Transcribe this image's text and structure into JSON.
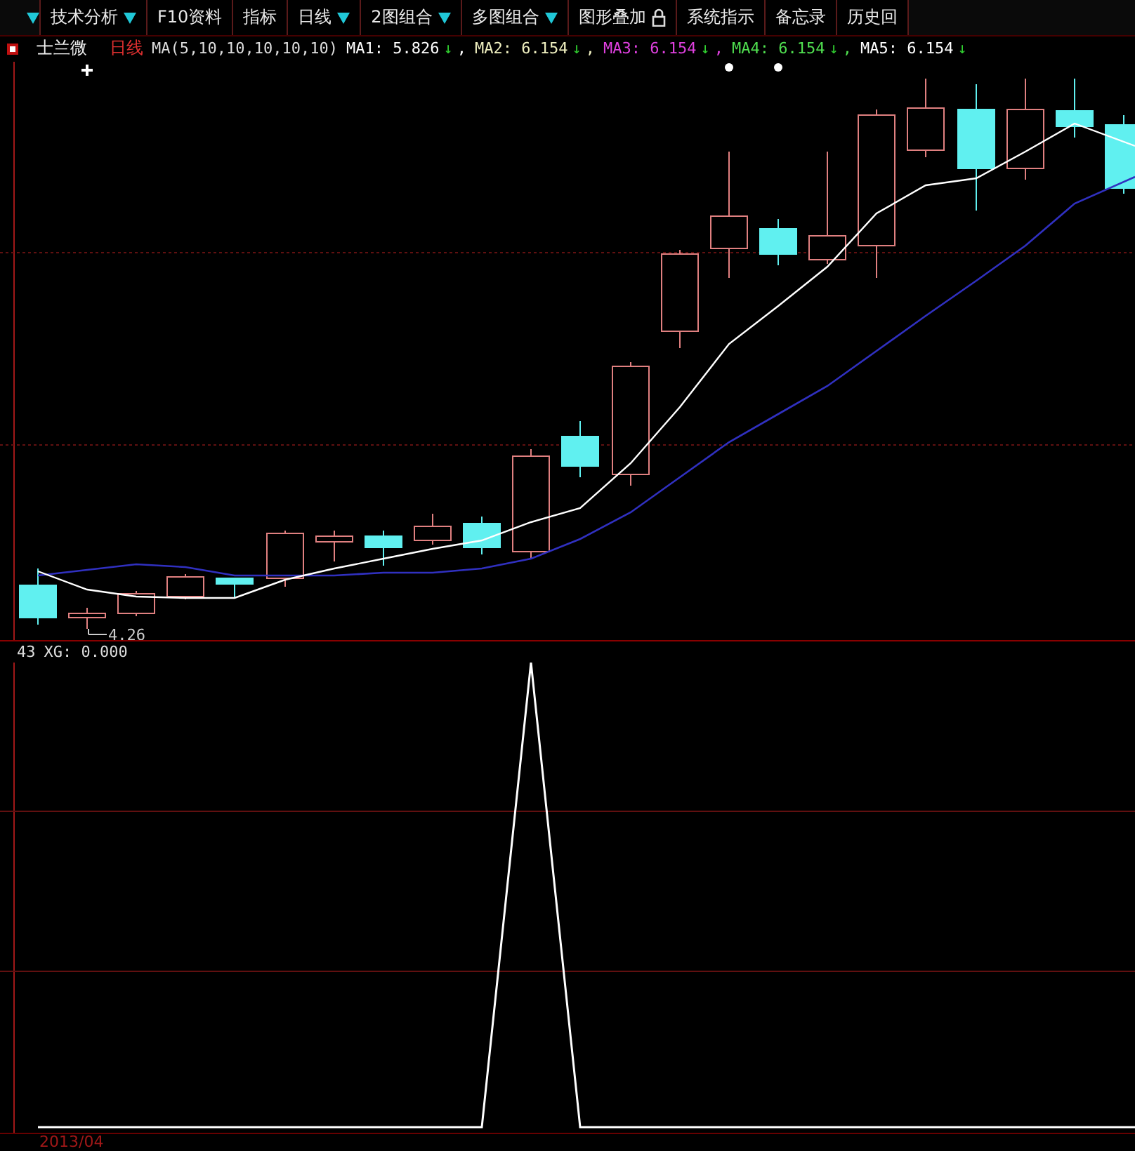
{
  "toolbar": {
    "buttons": [
      {
        "label": "技术分析",
        "dropdown": true
      },
      {
        "label": "F10资料",
        "dropdown": false
      },
      {
        "label": "指标",
        "dropdown": false
      },
      {
        "label": "日线",
        "dropdown": true
      },
      {
        "label": "2图组合",
        "dropdown": true
      },
      {
        "label": "多图组合",
        "dropdown": true
      },
      {
        "label": "图形叠加",
        "dropdown": false,
        "locked": true
      },
      {
        "label": "系统指示",
        "dropdown": false
      },
      {
        "label": "备忘录",
        "dropdown": false
      },
      {
        "label": "历史回",
        "dropdown": false
      }
    ]
  },
  "info": {
    "stock": "士兰微",
    "period": "日线",
    "formula": "MA(5,10,10,10,10,10)",
    "averages": [
      {
        "label": "MA1:",
        "value": "5.826",
        "arrow": "↓",
        "separator": ",",
        "color": "#ffffff"
      },
      {
        "label": "MA2:",
        "value": "6.154",
        "arrow": "↓",
        "separator": ",",
        "color": "#f0f0c0"
      },
      {
        "label": "MA3:",
        "value": "6.154",
        "arrow": "↓",
        "separator": ",",
        "color": "#e040e0"
      },
      {
        "label": "MA4:",
        "value": "6.154",
        "arrow": "↓",
        "separator": ",",
        "color": "#50e050"
      },
      {
        "label": "MA5:",
        "value": "6.154",
        "arrow": "↓",
        "color": "#ffffff"
      }
    ]
  },
  "price_chart": {
    "low_label": "4.26"
  },
  "indicator": {
    "axis_label": "43",
    "name": "XG:",
    "value": "0.000"
  },
  "date_axis": {
    "label": "2013/04"
  }
}
